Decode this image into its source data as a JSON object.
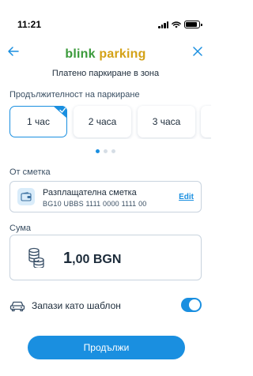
{
  "status_bar": {
    "time": "11:21",
    "battery_level": 0.9
  },
  "header": {
    "logo_part1": "blink",
    "logo_part2": "parking",
    "subtitle": "Платено паркиране в зона",
    "back_icon": "arrow-left-icon",
    "close_icon": "close-icon"
  },
  "duration": {
    "label": "Продължителност на паркиране",
    "options": [
      {
        "label": "1 час",
        "selected": true
      },
      {
        "label": "2 часа",
        "selected": false
      },
      {
        "label": "3 часа",
        "selected": false
      }
    ],
    "page_count": 3,
    "active_page": 1
  },
  "account": {
    "label": "От сметка",
    "name": "Разплащателна сметка",
    "iban": "BG10 UBBS 1111 0000 1111 00",
    "edit_label": "Edit",
    "icon": "wallet-icon"
  },
  "amount": {
    "label": "Сума",
    "whole": "1",
    "decimal": ",00 BGN",
    "icon": "coins-icon"
  },
  "template": {
    "label": "Запази като шаблон",
    "enabled": true,
    "icon": "car-icon"
  },
  "continue_label": "Продължи",
  "colors": {
    "accent": "#1a8fe0",
    "logo_green": "#3a9a3a",
    "logo_yellow": "#d4a217",
    "text": "#1c2b3a",
    "border": "#c8d3de"
  }
}
